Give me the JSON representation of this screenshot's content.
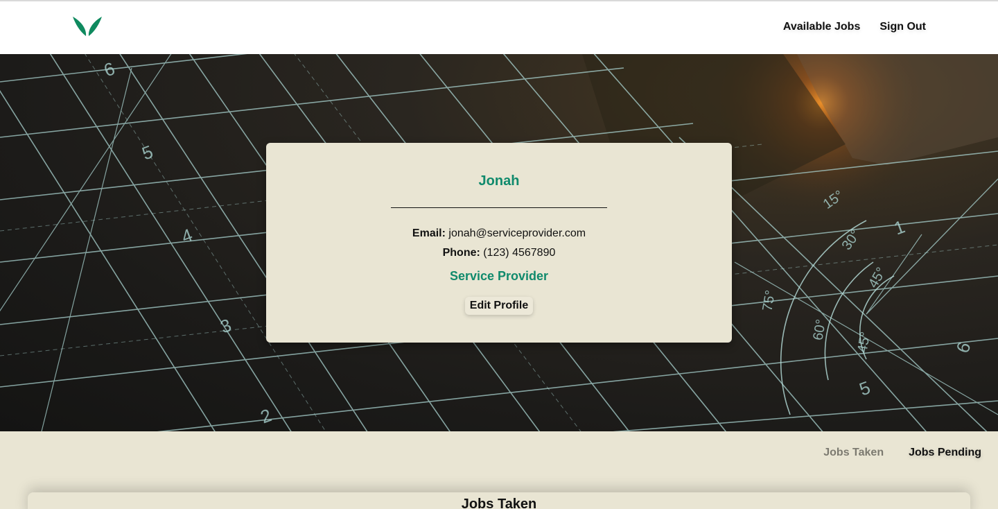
{
  "header": {
    "logo_icon": "leaf-logo-icon",
    "brand_color": "#0f8a5f",
    "nav": [
      "Available Jobs",
      "Sign Out"
    ]
  },
  "hero": {
    "background": "cutting-mat-photo",
    "ruler_numbers": [
      "6",
      "5",
      "4",
      "3",
      "2",
      "15°",
      "30°",
      "45°",
      "75°",
      "60°",
      "45°",
      "5",
      "6",
      "1"
    ]
  },
  "profile": {
    "name": "Jonah",
    "email_label": "Email:",
    "email": "jonah@serviceprovider.com",
    "phone_label": "Phone:",
    "phone": "(123) 4567890",
    "role": "Service Provider",
    "edit_button": "Edit Profile",
    "accent_color": "#108a6c",
    "card_color": "#e9e5d3"
  },
  "jobs": {
    "tabs": [
      "Jobs Taken",
      "Jobs Pending"
    ],
    "active_tab": "Jobs Pending",
    "section_title": "Jobs Taken"
  }
}
